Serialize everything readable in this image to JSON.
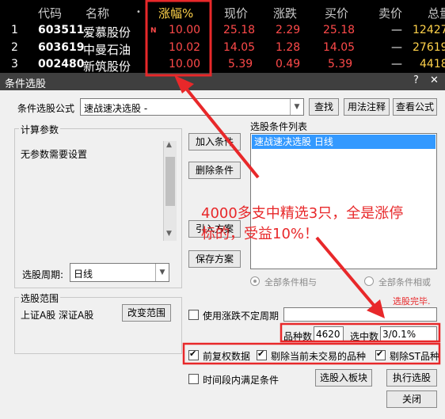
{
  "stock_table": {
    "headers": {
      "code": "代码",
      "name": "名称",
      "change_pct": "涨幅%",
      "price": "现价",
      "change": "涨跌",
      "bid": "买价",
      "ask": "卖价",
      "volume": "总量"
    },
    "rows": [
      {
        "idx": "1",
        "code": "603511",
        "name": "爱慕股份",
        "flag": "N",
        "change_pct": "10.00",
        "price": "25.18",
        "change": "2.29",
        "bid": "25.18",
        "ask": "—",
        "volume": "12427"
      },
      {
        "idx": "2",
        "code": "603619",
        "name": "中曼石油",
        "flag": "",
        "change_pct": "10.02",
        "price": "14.05",
        "change": "1.28",
        "bid": "14.05",
        "ask": "—",
        "volume": "27619"
      },
      {
        "idx": "3",
        "code": "002480",
        "name": "新筑股份",
        "flag": "",
        "change_pct": "10.00",
        "price": "5.39",
        "change": "0.49",
        "bid": "5.39",
        "ask": "—",
        "volume": "4418"
      }
    ]
  },
  "dialog": {
    "title": "条件选股",
    "formula_label": "条件选股公式",
    "formula_value": "速战速决选股 -",
    "find_button": "查找",
    "usage_button": "用法注释",
    "view_formula_button": "查看公式",
    "params_group": "计算参数",
    "params_text": "无参数需要设置",
    "add_condition": "加入条件",
    "delete_condition": "删除条件",
    "import_plan": "引入方案",
    "save_plan": "保存方案",
    "condition_list_label": "选股条件列表",
    "condition_item": "速战速决选股  日线",
    "all_and": "全部条件相与",
    "all_or": "全部条件相或",
    "period_label": "选股周期:",
    "period_value": "日线",
    "scope_group": "选股范围",
    "scope_text": "上证A股 深证A股",
    "change_scope": "改变范围",
    "status": "选股完毕.",
    "variable_period": "使用涨跌不定周期",
    "total_label": "品种数",
    "total_value": "4620",
    "selected_label": "选中数",
    "selected_value": "3/0.1%",
    "prior_rights": "前复权数据",
    "exclude_untraded": "剔除当前未交易的品种",
    "exclude_st": "剔除ST品种",
    "time_range": "时间段内满足条件",
    "to_board": "选股入板块",
    "execute": "执行选股",
    "close": "关闭"
  },
  "annotation": {
    "line1": "4000多支中精选3只，全是涨停",
    "line2": "标的，受益10%！"
  },
  "colors": {
    "red": "#e8282a",
    "highlight": "#3399ff",
    "dialog_bg": "#f0f0f0"
  }
}
